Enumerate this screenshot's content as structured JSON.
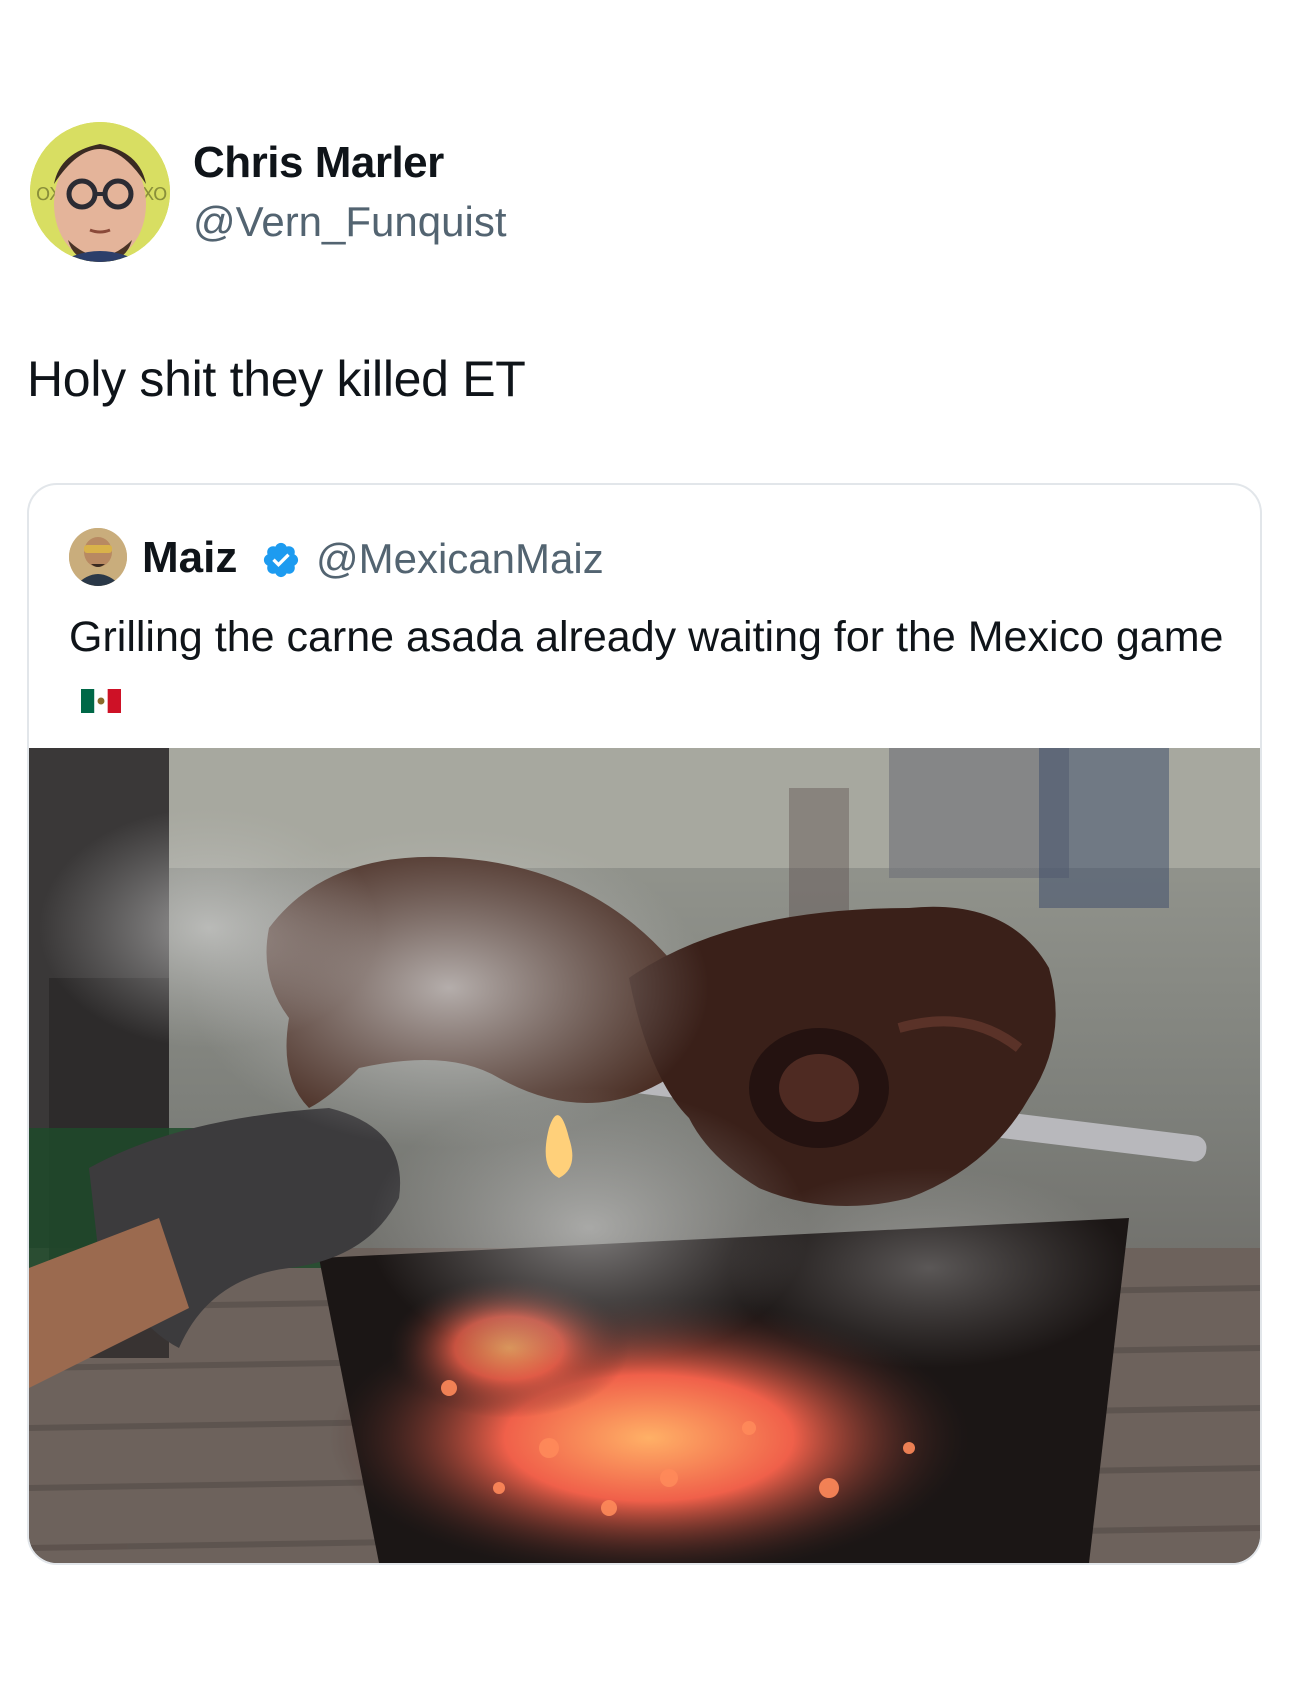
{
  "tweet": {
    "author_name": "Chris Marler",
    "author_handle": "@Vern_Funquist",
    "text": "Holy shit they killed ET",
    "avatar_icon": "user-avatar-icon"
  },
  "quoted_tweet": {
    "author_name": "Maiz",
    "author_handle": "@MexicanMaiz",
    "verified": true,
    "verified_color": "#1d9bf0",
    "text": "Grilling the carne asada already waiting for the Mexico game",
    "emoji": "mexico-flag-icon",
    "media_icon": "photo-icon"
  }
}
